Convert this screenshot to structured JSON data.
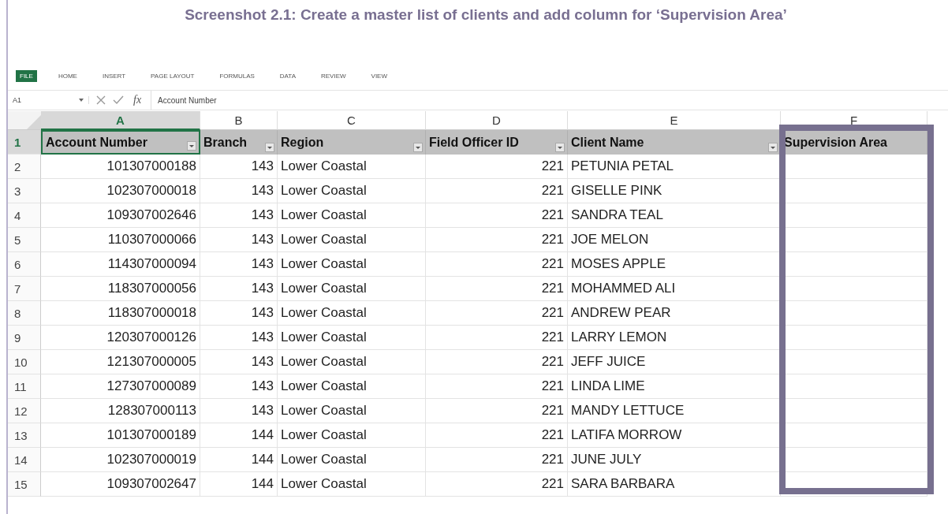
{
  "caption": "Screenshot 2.1: Create a master list of clients and add column for ‘Supervision Area’",
  "ribbon_tabs": [
    {
      "label": "FILE",
      "selected": true
    },
    {
      "label": "HOME",
      "selected": false
    },
    {
      "label": "INSERT",
      "selected": false
    },
    {
      "label": "PAGE LAYOUT",
      "selected": false
    },
    {
      "label": "FORMULAS",
      "selected": false
    },
    {
      "label": "DATA",
      "selected": false
    },
    {
      "label": "REVIEW",
      "selected": false
    },
    {
      "label": "VIEW",
      "selected": false
    }
  ],
  "formula_bar": {
    "cell_reference": "A1",
    "function_label": "fx",
    "value": "Account Number"
  },
  "sheet": {
    "columns": [
      {
        "letter": "A",
        "header": "Account Number",
        "filter": true,
        "selected": true,
        "highlighted": false
      },
      {
        "letter": "B",
        "header": "Branch",
        "filter": true,
        "selected": false,
        "highlighted": false
      },
      {
        "letter": "C",
        "header": "Region",
        "filter": true,
        "selected": false,
        "highlighted": false
      },
      {
        "letter": "D",
        "header": "Field Officer ID",
        "filter": true,
        "selected": false,
        "highlighted": false
      },
      {
        "letter": "E",
        "header": "Client Name",
        "filter": true,
        "selected": false,
        "highlighted": false
      },
      {
        "letter": "F",
        "header": "Supervision Area",
        "filter": false,
        "selected": false,
        "highlighted": true
      }
    ],
    "header_row_number": "1",
    "rows": [
      {
        "number": "2",
        "cells": [
          "101307000188",
          "143",
          "Lower Coastal",
          "221",
          "PETUNIA PETAL"
        ]
      },
      {
        "number": "3",
        "cells": [
          "102307000018",
          "143",
          "Lower Coastal",
          "221",
          "GISELLE PINK"
        ]
      },
      {
        "number": "4",
        "cells": [
          "109307002646",
          "143",
          "Lower Coastal",
          "221",
          "SANDRA TEAL"
        ]
      },
      {
        "number": "5",
        "cells": [
          "110307000066",
          "143",
          "Lower Coastal",
          "221",
          "JOE MELON"
        ]
      },
      {
        "number": "6",
        "cells": [
          "114307000094",
          "143",
          "Lower Coastal",
          "221",
          "MOSES APPLE"
        ]
      },
      {
        "number": "7",
        "cells": [
          "118307000056",
          "143",
          "Lower Coastal",
          "221",
          "MOHAMMED ALI"
        ]
      },
      {
        "number": "8",
        "cells": [
          "118307000018",
          "143",
          "Lower Coastal",
          "221",
          "ANDREW PEAR"
        ]
      },
      {
        "number": "9",
        "cells": [
          "120307000126",
          "143",
          "Lower Coastal",
          "221",
          "LARRY LEMON"
        ]
      },
      {
        "number": "10",
        "cells": [
          "121307000005",
          "143",
          "Lower Coastal",
          "221",
          "JEFF JUICE"
        ]
      },
      {
        "number": "11",
        "cells": [
          "127307000089",
          "143",
          "Lower Coastal",
          "221",
          "LINDA LIME"
        ]
      },
      {
        "number": "12",
        "cells": [
          "128307000113",
          "143",
          "Lower Coastal",
          "221",
          "MANDY LETTUCE"
        ]
      },
      {
        "number": "13",
        "cells": [
          "101307000189",
          "144",
          "Lower Coastal",
          "221",
          "LATIFA MORROW"
        ]
      },
      {
        "number": "14",
        "cells": [
          "102307000019",
          "144",
          "Lower Coastal",
          "221",
          "JUNE JULY"
        ]
      },
      {
        "number": "15",
        "cells": [
          "109307002647",
          "144",
          "Lower Coastal",
          "221",
          "SARA BARBARA"
        ]
      }
    ]
  }
}
